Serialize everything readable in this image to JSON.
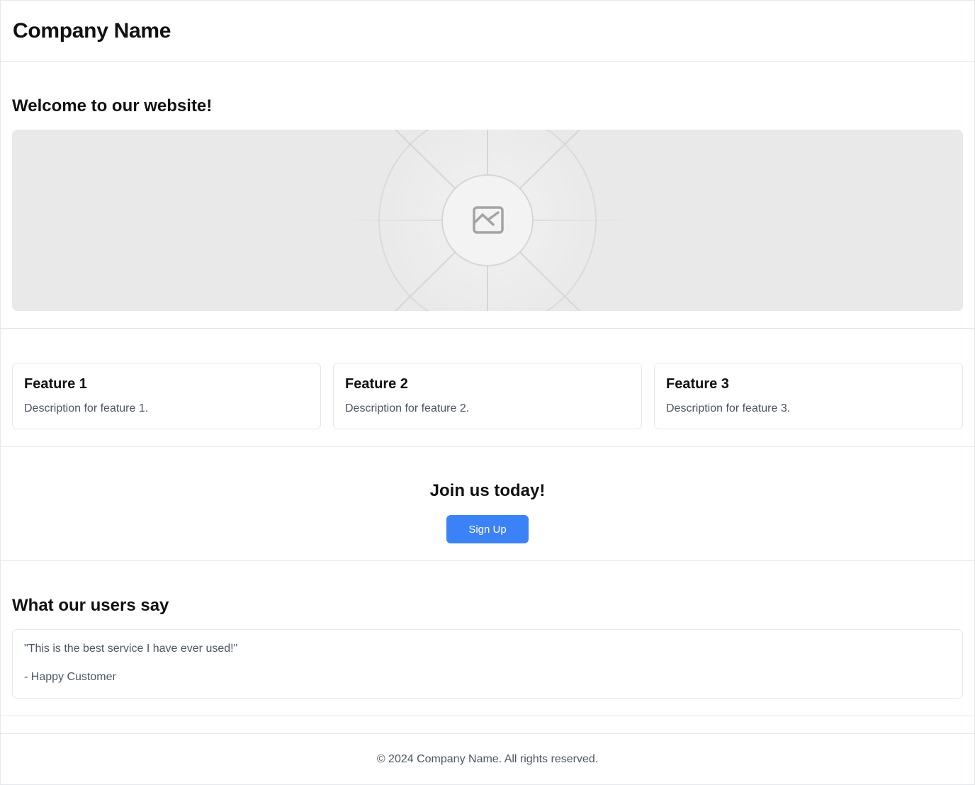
{
  "header": {
    "company_name": "Company Name"
  },
  "hero": {
    "title": "Welcome to our website!",
    "image_icon": "image-placeholder-icon"
  },
  "features": [
    {
      "title": "Feature 1",
      "description": "Description for feature 1."
    },
    {
      "title": "Feature 2",
      "description": "Description for feature 2."
    },
    {
      "title": "Feature 3",
      "description": "Description for feature 3."
    }
  ],
  "cta": {
    "title": "Join us today!",
    "button_label": "Sign Up",
    "button_color": "#3b82f6"
  },
  "testimonials": {
    "title": "What our users say",
    "quote": "\"This is the best service I have ever used!\"",
    "author": "- Happy Customer"
  },
  "footer": {
    "copyright": "© 2024 Company Name. All rights reserved."
  }
}
